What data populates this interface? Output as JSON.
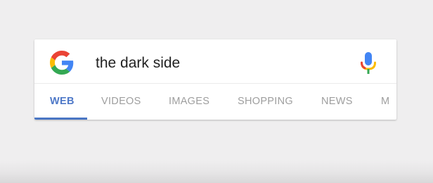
{
  "search": {
    "query": "the dark side"
  },
  "tabs": [
    {
      "label": "WEB",
      "active": true
    },
    {
      "label": "VIDEOS",
      "active": false
    },
    {
      "label": "IMAGES",
      "active": false
    },
    {
      "label": "SHOPPING",
      "active": false
    },
    {
      "label": "NEWS",
      "active": false
    },
    {
      "label": "M",
      "active": false
    }
  ],
  "icons": {
    "logo": "google-g-logo",
    "voice": "microphone-icon"
  },
  "colors": {
    "active_tab": "#4f79c8",
    "inactive_tab": "#9e9e9e",
    "google_blue": "#4285F4",
    "google_red": "#EA4335",
    "google_yellow": "#FBBC05",
    "google_green": "#34A853"
  }
}
